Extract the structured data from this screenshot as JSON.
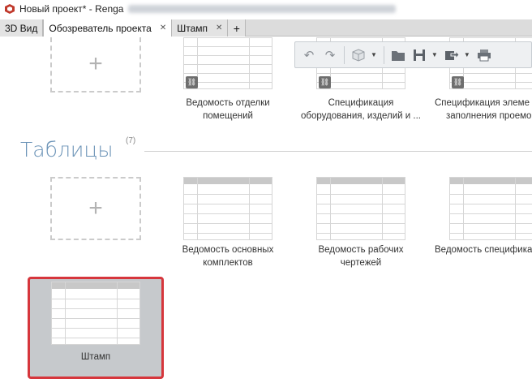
{
  "window": {
    "title": "Новый проект* - Renga"
  },
  "tabs": [
    {
      "label": "3D Вид",
      "closable": false
    },
    {
      "label": "Обозреватель проекта",
      "closable": true
    },
    {
      "label": "Штамп",
      "closable": true
    }
  ],
  "tab_add_label": "+",
  "toolbar": {
    "icons": [
      "undo-icon",
      "redo-icon",
      "cube-icon",
      "folder-icon",
      "save-icon",
      "export-icon",
      "print-icon"
    ]
  },
  "top_items": [
    {
      "label_line1": "Ведомость отделки",
      "label_line2": "помещений"
    },
    {
      "label_line1": "Спецификация",
      "label_line2": "оборудования, изделий и ..."
    },
    {
      "label_line1": "Спецификация элеме",
      "label_line2": "заполнения проемо"
    }
  ],
  "add_symbol": "+",
  "section": {
    "title": "Таблицы",
    "count": "(7)"
  },
  "tables": [
    {
      "label_line1": "Ведомость основных",
      "label_line2": "комплектов"
    },
    {
      "label_line1": "Ведомость рабочих",
      "label_line2": "чертежей"
    },
    {
      "label_line1": "Ведомость специфика",
      "label_line2": ""
    }
  ],
  "selected_table": {
    "label": "Штамп"
  },
  "colors": {
    "section_title": "#6b93b7",
    "selection_border": "#d6363c",
    "selection_bg": "#c6c9cc"
  }
}
